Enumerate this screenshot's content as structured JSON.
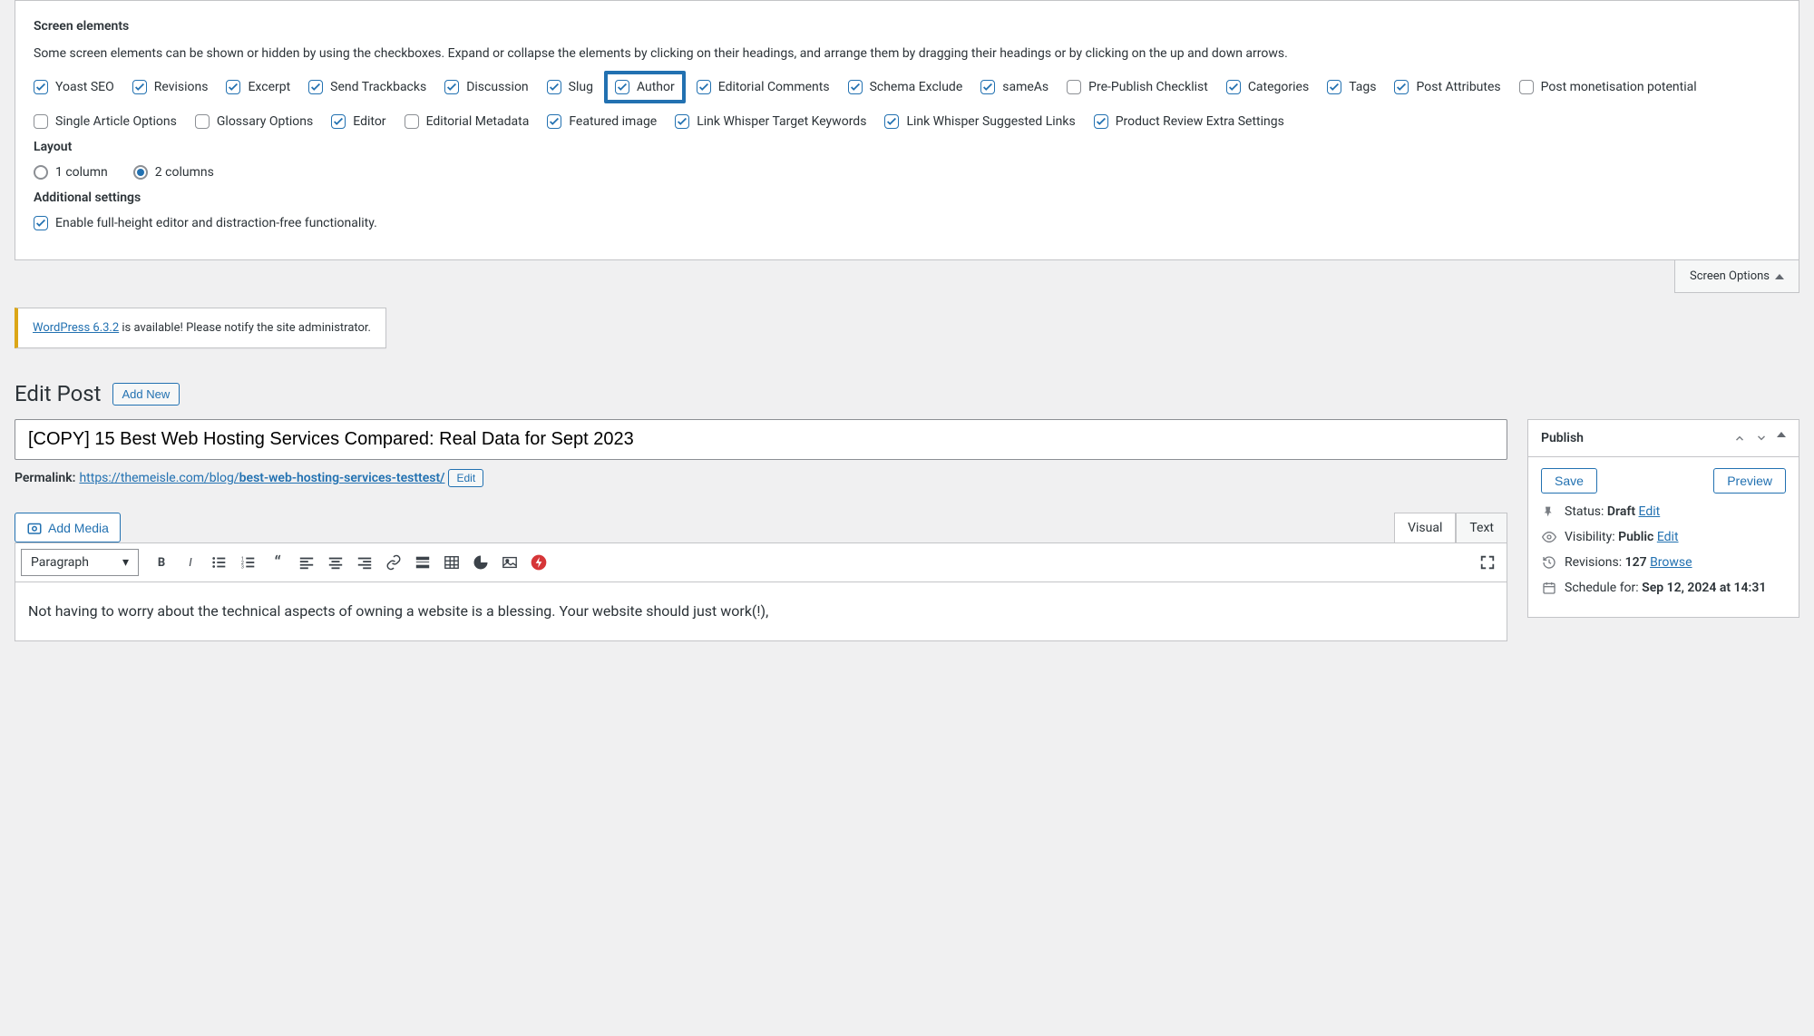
{
  "screen_options": {
    "heading": "Screen elements",
    "desc": "Some screen elements can be shown or hidden by using the checkboxes. Expand or collapse the elements by clicking on their headings, and arrange them by dragging their headings or by clicking on the up and down arrows.",
    "items": [
      {
        "label": "Yoast SEO",
        "checked": true
      },
      {
        "label": "Revisions",
        "checked": true
      },
      {
        "label": "Excerpt",
        "checked": true
      },
      {
        "label": "Send Trackbacks",
        "checked": true
      },
      {
        "label": "Discussion",
        "checked": true
      },
      {
        "label": "Slug",
        "checked": true
      },
      {
        "label": "Author",
        "checked": true,
        "highlight": true
      },
      {
        "label": "Editorial Comments",
        "checked": true
      },
      {
        "label": "Schema Exclude",
        "checked": true
      },
      {
        "label": "sameAs",
        "checked": true
      },
      {
        "label": "Pre-Publish Checklist",
        "checked": false
      },
      {
        "label": "Categories",
        "checked": true
      },
      {
        "label": "Tags",
        "checked": true
      },
      {
        "label": "Post Attributes",
        "checked": true
      },
      {
        "label": "Post monetisation potential",
        "checked": false
      },
      {
        "label": "Single Article Options",
        "checked": false
      },
      {
        "label": "Glossary Options",
        "checked": false
      },
      {
        "label": "Editor",
        "checked": true
      },
      {
        "label": "Editorial Metadata",
        "checked": false
      },
      {
        "label": "Featured image",
        "checked": true
      },
      {
        "label": "Link Whisper Target Keywords",
        "checked": true
      },
      {
        "label": "Link Whisper Suggested Links",
        "checked": true
      },
      {
        "label": "Product Review Extra Settings",
        "checked": true
      }
    ],
    "layout_heading": "Layout",
    "layout_options": {
      "col1": "1 column",
      "col2": "2 columns"
    },
    "additional_heading": "Additional settings",
    "additional_label": "Enable full-height editor and distraction-free functionality.",
    "tab_label": "Screen Options"
  },
  "notice": {
    "link_text": "WordPress 6.3.2",
    "after": " is available! Please notify the site administrator."
  },
  "page_heading": "Edit Post",
  "add_new": "Add New",
  "post_title": "[COPY] 15 Best Web Hosting Services Compared: Real Data for Sept 2023",
  "permalink": {
    "label": "Permalink:",
    "base": "https://themeisle.com/blog/",
    "slug": "best-web-hosting-services-testtest/",
    "edit_label": "Edit"
  },
  "media_button": "Add Media",
  "tabs": {
    "visual": "Visual",
    "text": "Text"
  },
  "toolbar_format": "Paragraph",
  "editor_content": "Not having to worry about the technical aspects of owning a website is a blessing. Your website should just work(!),",
  "publish": {
    "heading": "Publish",
    "save": "Save",
    "preview": "Preview",
    "status_label": "Status: ",
    "status_value": "Draft",
    "edit_link": "Edit",
    "visibility_label": "Visibility: ",
    "visibility_value": "Public",
    "revisions_label": "Revisions: ",
    "revisions_count": "127",
    "browse_link": "Browse",
    "schedule_label": "Schedule for: ",
    "schedule_value": "Sep 12, 2024 at 14:31"
  }
}
